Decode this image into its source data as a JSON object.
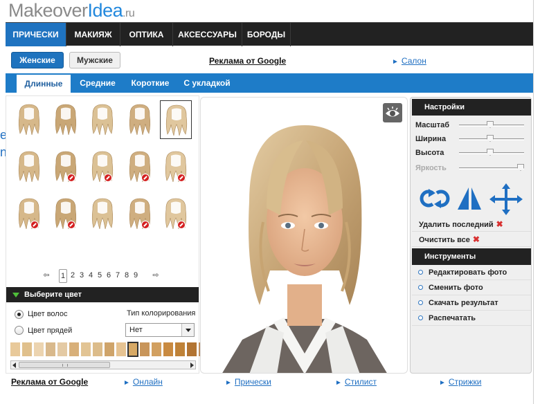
{
  "logo": {
    "part1": "Makeover",
    "part2": "Idea",
    "part3": ".ru"
  },
  "topnav": [
    "ПРИЧЕСКИ",
    "МАКИЯЖ",
    "ОПТИКА",
    "АКСЕССУАРЫ",
    "БОРОДЫ"
  ],
  "gender": {
    "female": "Женские",
    "male": "Мужские"
  },
  "ads": {
    "top": "Реклама от Google",
    "bottom": "Реклама от Google"
  },
  "links": {
    "salon": "Салон",
    "online": "Онлайн",
    "hairstyles": "Прически",
    "stylist": "Стилист",
    "haircuts": "Стрижки"
  },
  "subnav": [
    "Длинные",
    "Средние",
    "Короткие",
    "С укладкой"
  ],
  "pagination": {
    "pages": [
      "1",
      "2",
      "3",
      "4",
      "5",
      "6",
      "7",
      "8",
      "9"
    ],
    "current": "1"
  },
  "color": {
    "header": "Выберите цвет",
    "option1": "Цвет волос",
    "option2": "Цвет прядей",
    "type_label": "Тип колорирования",
    "type_value": "Нет",
    "swatches": [
      "#e8c99a",
      "#e0c08c",
      "#ecd4b0",
      "#d9b98c",
      "#e4caa4",
      "#d8b07a",
      "#e2c494",
      "#dcbc8a",
      "#cfa46a",
      "#e6c392",
      "#d7a965",
      "#c8955a",
      "#d2a060",
      "#c98a40",
      "#bf8238",
      "#b27432",
      "#c09060",
      "#a86c30",
      "#9c6228",
      "#8e5a26",
      "#b88a58"
    ]
  },
  "settings": {
    "header": "Настройки",
    "scale": "Масштаб",
    "width": "Ширина",
    "height": "Высота",
    "brightness": "Яркость",
    "delete_last": "Удалить последний",
    "clear_all": "Очистить все"
  },
  "tools": {
    "header": "Инструменты",
    "items": [
      "Редактировать фото",
      "Сменить фото",
      "Скачать результат",
      "Распечатать"
    ]
  },
  "accent": "#1f73c0"
}
